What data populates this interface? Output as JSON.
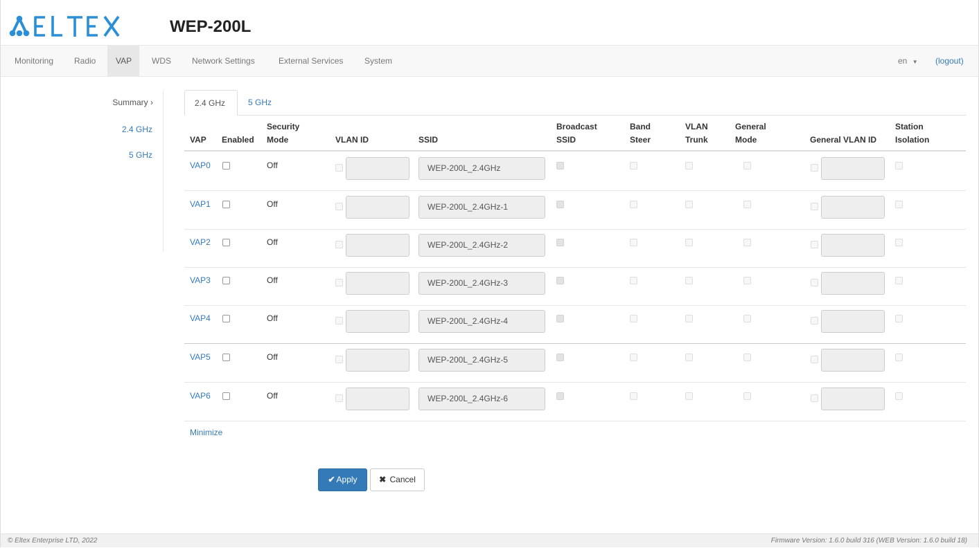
{
  "brand": {
    "logo_text": "ELTEX",
    "model": "WEP-200L",
    "accent": "#337ab7",
    "logo_color": "#2a8fd6"
  },
  "nav": {
    "items": [
      "Monitoring",
      "Radio",
      "VAP",
      "WDS",
      "Network Settings",
      "External Services",
      "System"
    ],
    "active": "VAP",
    "language": "en",
    "logout": "(logout)"
  },
  "sidebar": {
    "items": [
      "Summary",
      "2.4 GHz",
      "5 GHz"
    ],
    "current": "Summary"
  },
  "tabs": {
    "items": [
      "2.4 GHz",
      "5 GHz"
    ],
    "active": "2.4 GHz"
  },
  "table": {
    "headers": {
      "vap": "VAP",
      "enabled": "Enabled",
      "security_mode": [
        "Security",
        "Mode"
      ],
      "vlan_id": "VLAN ID",
      "ssid": "SSID",
      "broadcast_ssid": [
        "Broadcast",
        "SSID"
      ],
      "band_steer": [
        "Band",
        "Steer"
      ],
      "vlan_trunk": [
        "VLAN",
        "Trunk"
      ],
      "general_mode": [
        "General",
        "Mode"
      ],
      "general_vlan_id": "General VLAN ID",
      "station_isolation": [
        "Station",
        "Isolation"
      ]
    },
    "rows": [
      {
        "vap": "VAP0",
        "enabled": false,
        "security": "Off",
        "vlan_id": "",
        "ssid": "WEP-200L_2.4GHz",
        "broadcast_ssid": true
      },
      {
        "vap": "VAP1",
        "enabled": false,
        "security": "Off",
        "vlan_id": "",
        "ssid": "WEP-200L_2.4GHz-1",
        "broadcast_ssid": true
      },
      {
        "vap": "VAP2",
        "enabled": false,
        "security": "Off",
        "vlan_id": "",
        "ssid": "WEP-200L_2.4GHz-2",
        "broadcast_ssid": true
      },
      {
        "vap": "VAP3",
        "enabled": false,
        "security": "Off",
        "vlan_id": "",
        "ssid": "WEP-200L_2.4GHz-3",
        "broadcast_ssid": true
      },
      {
        "vap": "VAP4",
        "enabled": false,
        "security": "Off",
        "vlan_id": "",
        "ssid": "WEP-200L_2.4GHz-4",
        "broadcast_ssid": true
      },
      {
        "vap": "VAP5",
        "enabled": false,
        "security": "Off",
        "vlan_id": "",
        "ssid": "WEP-200L_2.4GHz-5",
        "broadcast_ssid": true
      },
      {
        "vap": "VAP6",
        "enabled": false,
        "security": "Off",
        "vlan_id": "",
        "ssid": "WEP-200L_2.4GHz-6",
        "broadcast_ssid": true
      }
    ]
  },
  "minimize": "Minimize",
  "actions": {
    "apply": "Apply",
    "apply_icon": "check-icon",
    "cancel": "Cancel",
    "cancel_icon": "close-icon"
  },
  "footer": {
    "copyright": "© Eltex Enterprise LTD, 2022",
    "version": "Firmware Version: 1.6.0 build 316 (WEB Version: 1.6.0 build 18)"
  }
}
